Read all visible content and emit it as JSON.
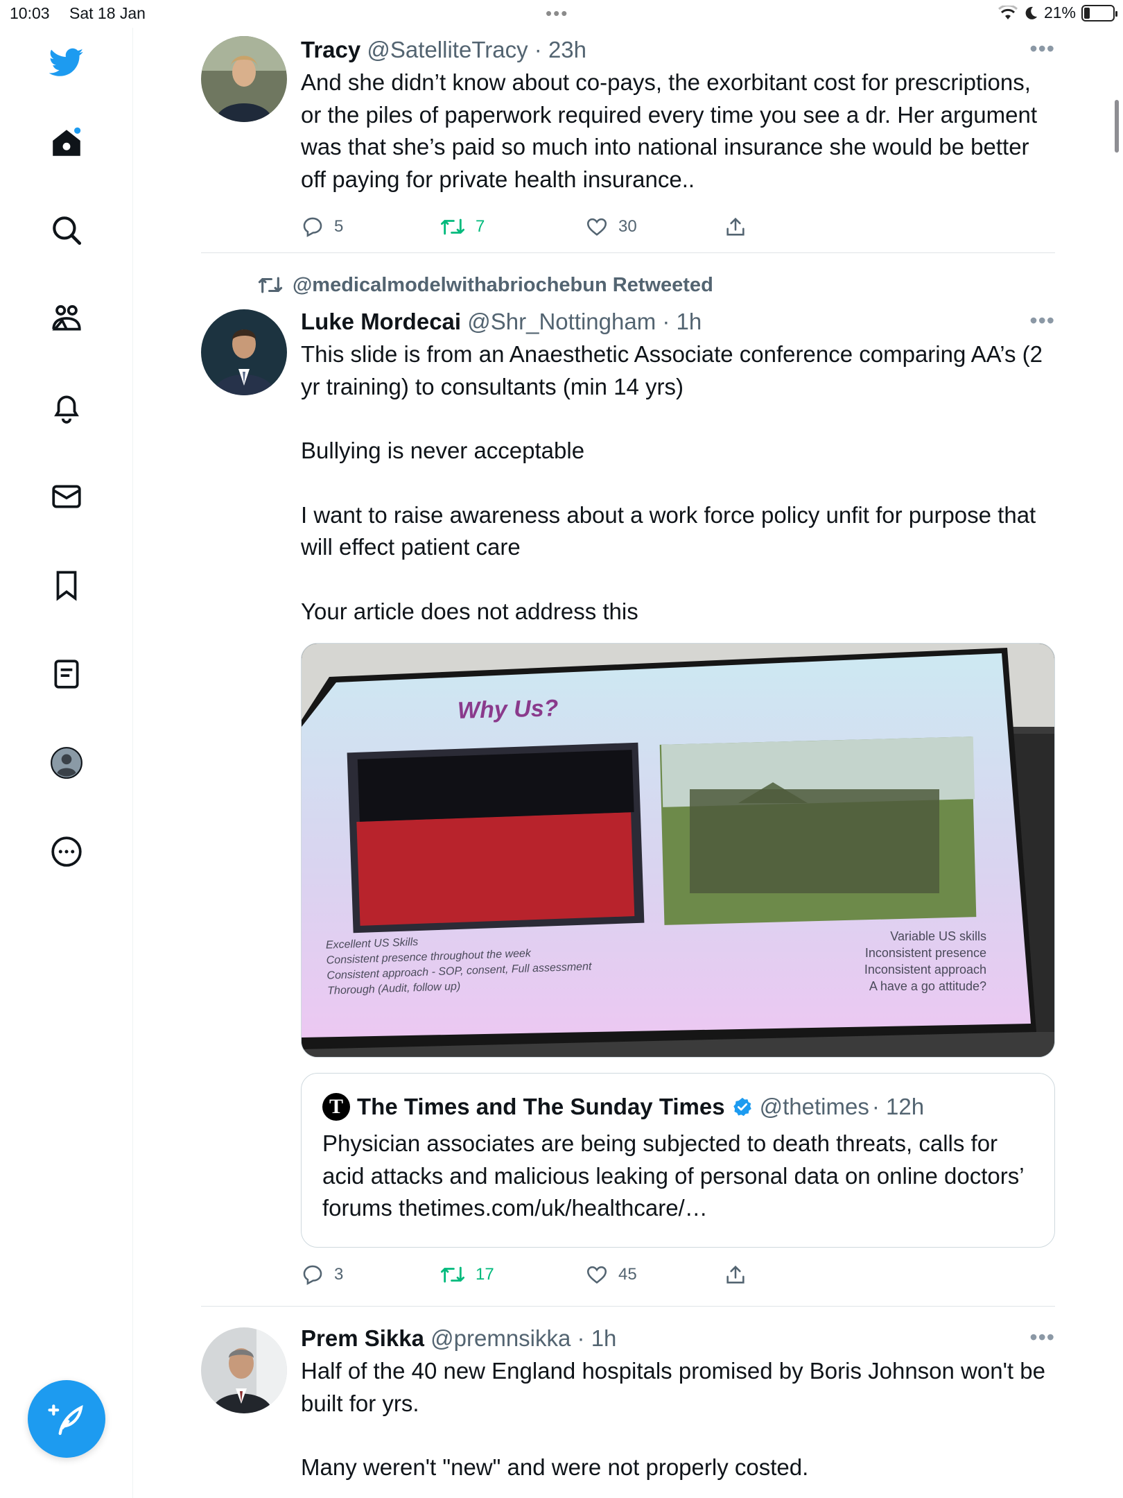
{
  "status_bar": {
    "time": "10:03",
    "date": "Sat 18 Jan",
    "battery": "21%",
    "battery_level": 0.21
  },
  "sidebar": {
    "items": [
      {
        "name": "twitter-logo-icon"
      },
      {
        "name": "home-icon"
      },
      {
        "name": "search-icon"
      },
      {
        "name": "communities-icon"
      },
      {
        "name": "notifications-bell-icon"
      },
      {
        "name": "messages-envelope-icon"
      },
      {
        "name": "bookmarks-icon"
      },
      {
        "name": "lists-icon"
      },
      {
        "name": "profile-avatar-icon"
      },
      {
        "name": "more-options-icon"
      }
    ],
    "compose_icon": "compose-feather-icon"
  },
  "tweets": [
    {
      "name": "Tracy",
      "handle": "@SatelliteTracy",
      "time": "· 23h",
      "text": "And she didn’t know about co-pays, the exorbitant cost for prescriptions, or the piles of paperwork required every time you see a dr. Her argument was that she’s paid so much into national insurance she would be better off paying for private health insurance..",
      "replies": "5",
      "retweets": "7",
      "likes": "30"
    },
    {
      "retweeted_by": "@medicalmodelwithabriochebun Retweeted",
      "name": "Luke Mordecai",
      "handle": "@Shr_Nottingham",
      "time": "· 1h",
      "paragraphs": [
        "This slide is from an Anaesthetic Associate conference comparing AA’s (2 yr training) to consultants (min 14 yrs)",
        "Bullying is never acceptable",
        "I want to raise awareness about a work force policy unfit for purpose that will effect patient care",
        "Your article does not address this"
      ],
      "slide": {
        "title": "Why Us?",
        "left_caption": [
          "Excellent US Skills",
          "Consistent presence throughout the week",
          "Consistent approach - SOP, consent, Full assessment",
          "Thorough (Audit, follow up)"
        ],
        "right_caption": [
          "Variable US skills",
          "Inconsistent presence",
          "Inconsistent approach",
          "A have a go attitude?"
        ]
      },
      "quote": {
        "logo": "T",
        "name": "The Times and The Sunday Times",
        "handle": "@thetimes",
        "time": "· 12h",
        "text": "Physician associates are being subjected to death threats, calls for acid attacks and malicious leaking of personal data on online doctors’ forums thetimes.com/uk/healthcare/…"
      },
      "replies": "3",
      "retweets": "17",
      "likes": "45"
    },
    {
      "name": "Prem Sikka",
      "handle": "@premnsikka",
      "time": "· 1h",
      "paragraphs": [
        "Half of the 40 new England hospitals promised by Boris Johnson won't be built for yrs.",
        "Many weren't \"new\" and were not properly costed."
      ]
    }
  ],
  "colors": {
    "accent": "#1d9bf0",
    "retweet_green": "#00ba7c",
    "muted": "#536471",
    "slide_title": "#8a3a8c"
  }
}
